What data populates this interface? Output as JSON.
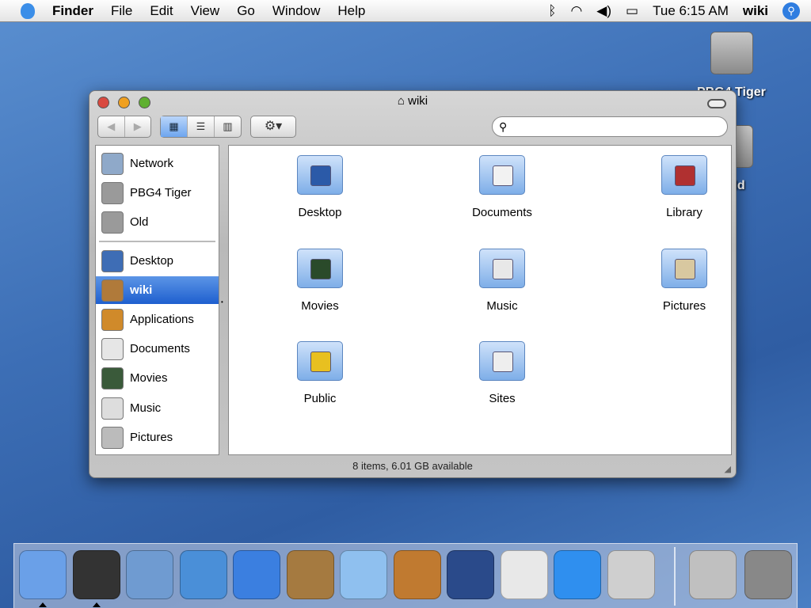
{
  "menubar": {
    "apple": "apple-menu",
    "items": [
      "Finder",
      "File",
      "Edit",
      "View",
      "Go",
      "Window",
      "Help"
    ],
    "clock": "Tue 6:15 AM",
    "user": "wiki"
  },
  "desktop": {
    "icons": [
      {
        "label": "PBG4 Tiger",
        "icon": "hard-drive-icon"
      },
      {
        "label": "Old",
        "icon": "hard-drive-icon"
      }
    ]
  },
  "window": {
    "title": "wiki",
    "search_placeholder": "",
    "status": "8 items, 6.01 GB available",
    "nav": [
      "◀",
      "▶"
    ],
    "views": [
      "icon-view",
      "list-view",
      "column-view"
    ],
    "active_view": "icon-view",
    "action": "⚙▾",
    "sidebar": {
      "devices": [
        {
          "label": "Network",
          "color": "#8fa9c9"
        },
        {
          "label": "PBG4 Tiger",
          "color": "#9a9a9a"
        },
        {
          "label": "Old",
          "color": "#9a9a9a"
        }
      ],
      "places": [
        {
          "label": "Desktop",
          "color": "#3e6db5"
        },
        {
          "label": "wiki",
          "color": "#b07a3a",
          "selected": true
        },
        {
          "label": "Applications",
          "color": "#d08a2a"
        },
        {
          "label": "Documents",
          "color": "#e6e6e6"
        },
        {
          "label": "Movies",
          "color": "#3a5a3a"
        },
        {
          "label": "Music",
          "color": "#ddd"
        },
        {
          "label": "Pictures",
          "color": "#bbb"
        }
      ]
    },
    "items": [
      {
        "label": "Desktop",
        "emblem": "#2b5aa8"
      },
      {
        "label": "Documents",
        "emblem": "#f2f2f2"
      },
      {
        "label": "Library",
        "emblem": "#b03030"
      },
      {
        "label": "Movies",
        "emblem": "#2a4a2a"
      },
      {
        "label": "Music",
        "emblem": "#e8e8e8"
      },
      {
        "label": "Pictures",
        "emblem": "#d8c8a0"
      },
      {
        "label": "Public",
        "emblem": "#e8c020"
      },
      {
        "label": "Sites",
        "emblem": "#eeeeee"
      }
    ]
  },
  "dock": {
    "apps": [
      {
        "name": "finder",
        "color": "#6aa0e8",
        "running": true
      },
      {
        "name": "dashboard",
        "color": "#333",
        "running": true
      },
      {
        "name": "mail",
        "color": "#6f9bd1"
      },
      {
        "name": "safari",
        "color": "#4a8fd8"
      },
      {
        "name": "ichat",
        "color": "#3b7fe0"
      },
      {
        "name": "address-book",
        "color": "#a57a40"
      },
      {
        "name": "itunes",
        "color": "#8fc0ef"
      },
      {
        "name": "iphoto",
        "color": "#c07a30"
      },
      {
        "name": "imovie",
        "color": "#2a4a8a"
      },
      {
        "name": "ical",
        "color": "#e8e8e8"
      },
      {
        "name": "quicktime",
        "color": "#2f8fef"
      },
      {
        "name": "system-preferences",
        "color": "#cfcfcf"
      }
    ],
    "right": [
      {
        "name": "internet-connect",
        "color": "#c0c0c0"
      },
      {
        "name": "trash",
        "color": "#888"
      }
    ]
  }
}
